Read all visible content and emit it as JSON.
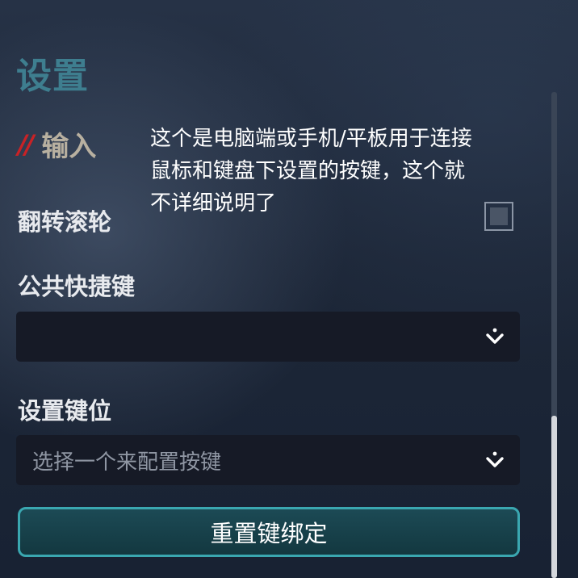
{
  "header": {
    "title": "设置"
  },
  "section": {
    "slashes": "//",
    "label": "输入"
  },
  "annotation": {
    "line1": "这个是电脑端或手机/平板用于连接",
    "line2": "鼠标和键盘下设置的按键，这个就",
    "line3": "不详细说明了"
  },
  "settings": {
    "flip_wheel_label": "翻转滚轮",
    "flip_wheel_checked": false,
    "public_hotkeys_label": "公共快捷键",
    "public_hotkeys_value": "",
    "keymap_label": "设置键位",
    "keymap_placeholder": "选择一个来配置按键"
  },
  "actions": {
    "reset_label": "重置键绑定"
  },
  "icons": {
    "dropdown": "chevron-down-icon",
    "checkbox": "checkbox-icon"
  },
  "colors": {
    "title": "#3e7e8f",
    "slashes": "#c82226",
    "reset_border": "#3aa7b0"
  },
  "scrollbar": {
    "thumb_start_fraction": 0.67,
    "thumb_size_fraction": 0.33
  }
}
